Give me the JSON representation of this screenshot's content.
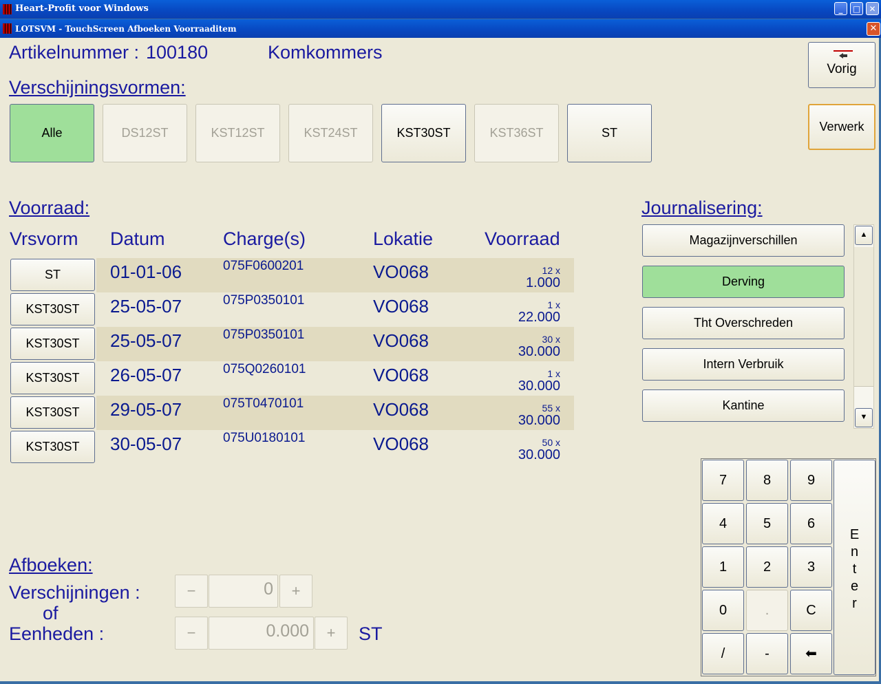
{
  "window": {
    "title": "Heart-Profit voor Windows",
    "btn_min": "_",
    "btn_max": "□",
    "btn_close": "✕"
  },
  "dialog": {
    "title": "LOTSVM - TouchScreen Afboeken Voorraaditem",
    "btn_close": "✕"
  },
  "article": {
    "label": "Artikelnummer :",
    "number": "100180",
    "name": "Komkommers"
  },
  "forms": {
    "heading": "Verschijningsvormen:",
    "buttons": [
      {
        "label": "Alle",
        "state": "selected"
      },
      {
        "label": "DS12ST",
        "state": "disabled"
      },
      {
        "label": "KST12ST",
        "state": "disabled"
      },
      {
        "label": "KST24ST",
        "state": "disabled"
      },
      {
        "label": "KST30ST",
        "state": "enabled"
      },
      {
        "label": "KST36ST",
        "state": "disabled"
      },
      {
        "label": "ST",
        "state": "enabled"
      }
    ]
  },
  "actions": {
    "prev_label": "Vorig",
    "prev_icon": "arrow-left-icon",
    "process_label": "Verwerk"
  },
  "stock": {
    "heading": "Voorraad:",
    "columns": [
      "Vrsvorm",
      "Datum",
      "Charge(s)",
      "Lokatie",
      "Voorraad"
    ],
    "rows": [
      {
        "form": "ST",
        "date": "01-01-06",
        "charge": "075F0600201",
        "location": "VO068",
        "count": "12 x",
        "amount": "1.000"
      },
      {
        "form": "KST30ST",
        "date": "25-05-07",
        "charge": "075P0350101",
        "location": "VO068",
        "count": "1 x",
        "amount": "22.000"
      },
      {
        "form": "KST30ST",
        "date": "25-05-07",
        "charge": "075P0350101",
        "location": "VO068",
        "count": "30 x",
        "amount": "30.000"
      },
      {
        "form": "KST30ST",
        "date": "26-05-07",
        "charge": "075Q0260101",
        "location": "VO068",
        "count": "1 x",
        "amount": "30.000"
      },
      {
        "form": "KST30ST",
        "date": "29-05-07",
        "charge": "075T0470101",
        "location": "VO068",
        "count": "55 x",
        "amount": "30.000"
      },
      {
        "form": "KST30ST",
        "date": "30-05-07",
        "charge": "075U0180101",
        "location": "VO068",
        "count": "50 x",
        "amount": "30.000"
      }
    ]
  },
  "journal": {
    "heading": "Journalisering:",
    "items": [
      {
        "label": "Magazijnverschillen",
        "selected": false
      },
      {
        "label": "Derving",
        "selected": true
      },
      {
        "label": "Tht Overschreden",
        "selected": false
      },
      {
        "label": "Intern Verbruik",
        "selected": false
      },
      {
        "label": "Kantine",
        "selected": false
      }
    ]
  },
  "booking": {
    "heading": "Afboeken:",
    "appearances_label": "Verschijningen :",
    "or_label": "of",
    "units_label": "Eenheden :",
    "appearances_value": "0",
    "units_value": "0.000",
    "unit": "ST",
    "minus": "−",
    "plus": "+"
  },
  "keypad": {
    "keys": [
      "7",
      "8",
      "9",
      "4",
      "5",
      "6",
      "1",
      "2",
      "3",
      "0",
      ".",
      "C",
      "/",
      "-",
      "⬅"
    ],
    "enter": [
      "E",
      "n",
      "t",
      "e",
      "r"
    ]
  },
  "colors": {
    "selected": "#9fdf9a",
    "text": "#0a1a8f",
    "row_alt": "#e1dbc0",
    "background": "#ece9d8"
  }
}
